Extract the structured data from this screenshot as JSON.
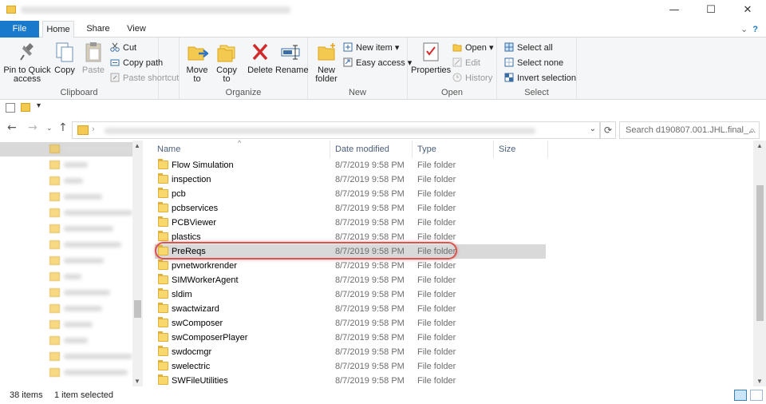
{
  "window": {
    "controls": {
      "minimize": "—",
      "maximize": "☐",
      "close": "✕"
    }
  },
  "tabs": [
    {
      "label": "File"
    },
    {
      "label": "Home"
    },
    {
      "label": "Share"
    },
    {
      "label": "View"
    }
  ],
  "ribbon": {
    "clipboard": {
      "label": "Clipboard",
      "pin": "Pin to Quick access",
      "copy": "Copy",
      "paste": "Paste",
      "cut": "Cut",
      "copy_path": "Copy path",
      "paste_shortcut": "Paste shortcut"
    },
    "organize": {
      "label": "Organize",
      "move_to": "Move to",
      "copy_to": "Copy to",
      "delete": "Delete",
      "rename": "Rename"
    },
    "new": {
      "label": "New",
      "new_folder": "New folder",
      "new_item": "New item",
      "easy_access": "Easy access"
    },
    "open": {
      "label": "Open",
      "properties": "Properties",
      "open": "Open",
      "edit": "Edit",
      "history": "History"
    },
    "select": {
      "label": "Select",
      "select_all": "Select all",
      "select_none": "Select none",
      "invert_selection": "Invert selection"
    }
  },
  "search": {
    "placeholder": "Search d190807.001.JHL.final_..."
  },
  "columns": {
    "name": "Name",
    "date": "Date modified",
    "type": "Type",
    "size": "Size"
  },
  "files": [
    {
      "name": "Flow Simulation",
      "date": "8/7/2019 9:58 PM",
      "type": "File folder"
    },
    {
      "name": "inspection",
      "date": "8/7/2019 9:58 PM",
      "type": "File folder"
    },
    {
      "name": "pcb",
      "date": "8/7/2019 9:58 PM",
      "type": "File folder"
    },
    {
      "name": "pcbservices",
      "date": "8/7/2019 9:58 PM",
      "type": "File folder"
    },
    {
      "name": "PCBViewer",
      "date": "8/7/2019 9:58 PM",
      "type": "File folder"
    },
    {
      "name": "plastics",
      "date": "8/7/2019 9:58 PM",
      "type": "File folder"
    },
    {
      "name": "PreReqs",
      "date": "8/7/2019 9:58 PM",
      "type": "File folder",
      "selected": true
    },
    {
      "name": "pvnetworkrender",
      "date": "8/7/2019 9:58 PM",
      "type": "File folder"
    },
    {
      "name": "SIMWorkerAgent",
      "date": "8/7/2019 9:58 PM",
      "type": "File folder"
    },
    {
      "name": "sldim",
      "date": "8/7/2019 9:58 PM",
      "type": "File folder"
    },
    {
      "name": "swactwizard",
      "date": "8/7/2019 9:58 PM",
      "type": "File folder"
    },
    {
      "name": "swComposer",
      "date": "8/7/2019 9:58 PM",
      "type": "File folder"
    },
    {
      "name": "swComposerPlayer",
      "date": "8/7/2019 9:58 PM",
      "type": "File folder"
    },
    {
      "name": "swdocmgr",
      "date": "8/7/2019 9:58 PM",
      "type": "File folder"
    },
    {
      "name": "swelectric",
      "date": "8/7/2019 9:58 PM",
      "type": "File folder"
    },
    {
      "name": "SWFileUtilities",
      "date": "8/7/2019 9:58 PM",
      "type": "File folder"
    }
  ],
  "status": {
    "item_count": "38 items",
    "selected": "1 item selected"
  },
  "colors": {
    "file_tab": "#1979ca",
    "selection": "#d9d9d9",
    "highlight_ring": "#d9534f",
    "header_text": "#4c607a"
  },
  "icons": [
    "folder-icon",
    "pin-icon",
    "copy-icon",
    "paste-icon",
    "cut-icon",
    "copy-path-icon",
    "paste-shortcut-icon",
    "move-to-icon",
    "copy-to-icon",
    "delete-icon",
    "rename-icon",
    "new-folder-icon",
    "new-item-icon",
    "easy-access-icon",
    "properties-icon",
    "open-icon",
    "edit-icon",
    "history-icon",
    "select-all-icon",
    "select-none-icon",
    "invert-selection-icon",
    "back-icon",
    "forward-icon",
    "up-icon",
    "refresh-icon",
    "search-icon",
    "details-view-icon",
    "large-icons-view-icon"
  ]
}
